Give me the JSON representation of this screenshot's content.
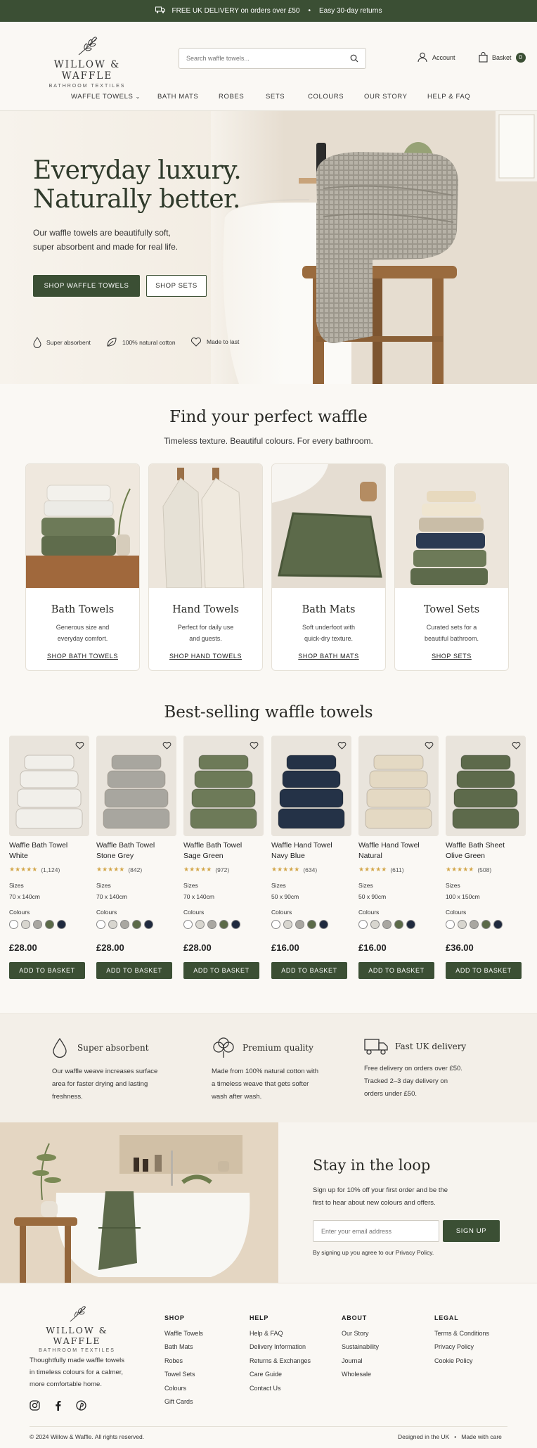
{
  "announcement": {
    "text_1": "FREE UK DELIVERY on orders over £50",
    "sep": "•",
    "text_2": "Easy 30-day returns"
  },
  "brand": {
    "name": "WILLOW & WAFFLE",
    "tagline": "BATHROOM TEXTILES",
    "primary": "#3b4f34",
    "background": "#faf8f4"
  },
  "search": {
    "placeholder": "Search waffle towels..."
  },
  "account": {
    "label": "Account"
  },
  "basket": {
    "label": "Basket",
    "count": "0"
  },
  "nav": {
    "items": [
      {
        "label": "WAFFLE TOWELS"
      },
      {
        "label": "BATH MATS"
      },
      {
        "label": "ROBES"
      },
      {
        "label": "SETS"
      },
      {
        "label": "COLOURS"
      },
      {
        "label": "OUR STORY"
      },
      {
        "label": "HELP & FAQ"
      }
    ]
  },
  "hero": {
    "title_1": "Everyday luxury.",
    "title_2": "Naturally better.",
    "text_1": "Our waffle towels are beautifully soft,",
    "text_2": "super absorbent and made for real life.",
    "primary_cta": "SHOP WAFFLE TOWELS",
    "secondary_cta": "SHOP SETS",
    "features": [
      {
        "icon": "droplet-icon",
        "label": "Super absorbent"
      },
      {
        "icon": "leaf-icon",
        "label": "100% natural cotton"
      },
      {
        "icon": "heart-icon",
        "label": "Made to last"
      }
    ]
  },
  "categories": {
    "title": "Find your perfect waffle",
    "subtitle": "Timeless texture. Beautiful colours. For every bathroom.",
    "items": [
      {
        "title": "Bath Towels",
        "desc_1": "Generous size and",
        "desc_2": "everyday comfort.",
        "link": "SHOP BATH TOWELS"
      },
      {
        "title": "Hand Towels",
        "desc_1": "Perfect for daily use",
        "desc_2": "and guests.",
        "link": "SHOP HAND TOWELS"
      },
      {
        "title": "Bath Mats",
        "desc_1": "Soft underfoot with",
        "desc_2": "quick-dry texture.",
        "link": "SHOP BATH MATS"
      },
      {
        "title": "Towel Sets",
        "desc_1": "Curated sets for a",
        "desc_2": "beautiful bathroom.",
        "link": "SHOP SETS"
      }
    ]
  },
  "bestsellers": {
    "title": "Best-selling waffle towels",
    "sizes_label": "Sizes",
    "colours_label": "Colours",
    "stars": "★★★★★",
    "add_label": "ADD TO BASKET",
    "products": [
      {
        "name_1": "Waffle Bath Towel",
        "name_2": "White",
        "reviews": "(1,124)",
        "size": "70 x 140cm",
        "price": "£28.00",
        "color": "#f1efea"
      },
      {
        "name_1": "Waffle Bath Towel",
        "name_2": "Stone Grey",
        "reviews": "(842)",
        "size": "70 x 140cm",
        "price": "£28.00",
        "color": "#a8a69f"
      },
      {
        "name_1": "Waffle Bath Towel",
        "name_2": "Sage Green",
        "reviews": "(972)",
        "size": "70 x 140cm",
        "price": "£28.00",
        "color": "#6d7a58"
      },
      {
        "name_1": "Waffle Hand Towel",
        "name_2": "Navy Blue",
        "reviews": "(634)",
        "size": "50 x 90cm",
        "price": "£16.00",
        "color": "#243247"
      },
      {
        "name_1": "Waffle Hand Towel",
        "name_2": "Natural",
        "reviews": "(611)",
        "size": "50 x 90cm",
        "price": "£16.00",
        "color": "#e4d9c3"
      },
      {
        "name_1": "Waffle Bath Sheet",
        "name_2": "Olive Green",
        "reviews": "(508)",
        "size": "100 x 150cm",
        "price": "£36.00",
        "color": "#5d6a4b"
      }
    ],
    "swatch_colors": [
      "#ffffff",
      "#d8d6cf",
      "#a9a7a1",
      "#5b6a48",
      "#1f2a3e"
    ]
  },
  "benefits": [
    {
      "icon": "droplet-icon",
      "title": "Super absorbent",
      "l1": "Our waffle weave increases surface",
      "l2": "area for faster drying and lasting",
      "l3": "freshness."
    },
    {
      "icon": "cotton-icon",
      "title": "Premium quality",
      "l1": "Made from 100% natural cotton with",
      "l2": "a timeless weave that gets softer",
      "l3": "wash after wash."
    },
    {
      "icon": "truck-icon",
      "title": "Fast UK delivery",
      "l1": "Free delivery on orders over £50.",
      "l2": "Tracked 2–3 day delivery on",
      "l3": "orders under £50."
    }
  ],
  "newsletter": {
    "title": "Stay in the loop",
    "text_1": "Sign up for 10% off your first order and be the",
    "text_2": "first to hear about new colours and offers.",
    "placeholder": "Enter your email address",
    "button": "SIGN UP",
    "legal": "By signing up you agree to our Privacy Policy."
  },
  "footer": {
    "about_1": "Thoughtfully made waffle towels",
    "about_2": "in timeless colours for a calmer,",
    "about_3": "more comfortable home.",
    "social": [
      {
        "icon": "instagram-icon"
      },
      {
        "icon": "facebook-icon"
      },
      {
        "icon": "pinterest-icon"
      }
    ],
    "columns": [
      {
        "heading": "SHOP",
        "items": [
          "Waffle Towels",
          "Bath Mats",
          "Robes",
          "Towel Sets",
          "Colours",
          "Gift Cards"
        ]
      },
      {
        "heading": "HELP",
        "items": [
          "Help & FAQ",
          "Delivery Information",
          "Returns & Exchanges",
          "Care Guide",
          "Contact Us"
        ]
      },
      {
        "heading": "ABOUT",
        "items": [
          "Our Story",
          "Sustainability",
          "Journal",
          "Wholesale"
        ]
      },
      {
        "heading": "LEGAL",
        "items": [
          "Terms & Conditions",
          "Privacy Policy",
          "Cookie Policy"
        ]
      }
    ],
    "copyright": "© 2024 Willow & Waffle. All rights reserved.",
    "designed": "Designed in the UK",
    "sep": "•",
    "made": "Made with care"
  }
}
